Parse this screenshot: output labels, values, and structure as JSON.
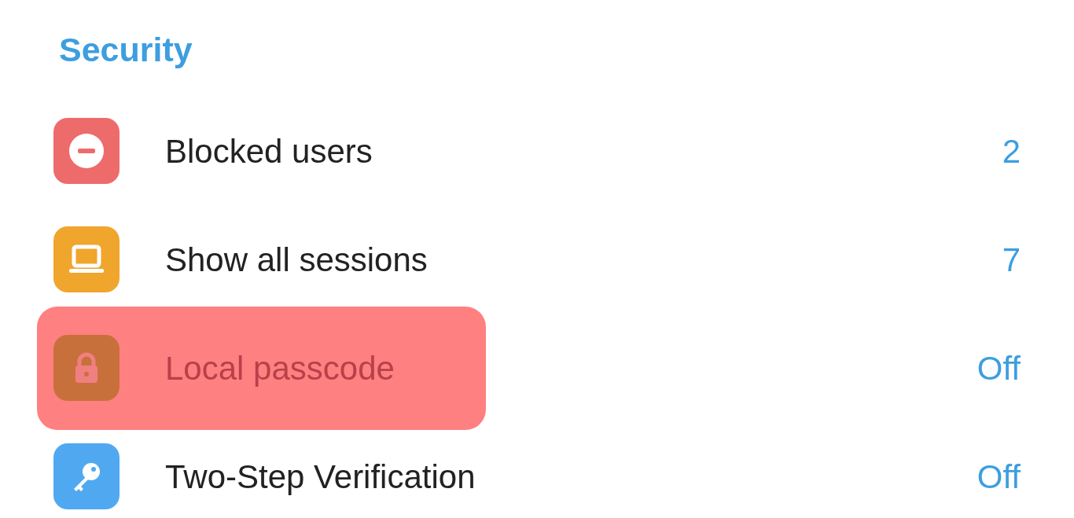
{
  "section_title": "Security",
  "rows": [
    {
      "kind": "blocked",
      "label": "Blocked users",
      "value": "2",
      "highlighted": false
    },
    {
      "kind": "sessions",
      "label": "Show all sessions",
      "value": "7",
      "highlighted": false
    },
    {
      "kind": "passcode",
      "label": "Local passcode",
      "value": "Off",
      "highlighted": true
    },
    {
      "kind": "twostep",
      "label": "Two-Step Verification",
      "value": "Off",
      "highlighted": false
    }
  ]
}
